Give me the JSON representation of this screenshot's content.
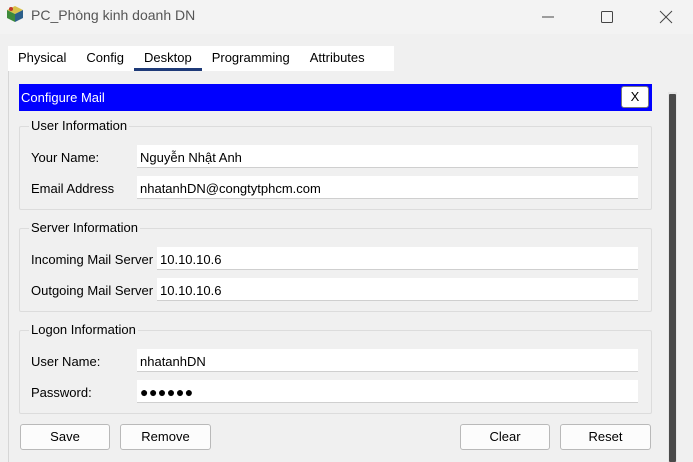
{
  "window": {
    "title": "PC_Phòng kinh doanh DN"
  },
  "tabs": [
    {
      "label": "Physical"
    },
    {
      "label": "Config"
    },
    {
      "label": "Desktop",
      "active": true
    },
    {
      "label": "Programming"
    },
    {
      "label": "Attributes"
    }
  ],
  "configure_mail": {
    "title": "Configure Mail",
    "close_label": "X",
    "colors": {
      "header_bg": "#0000ff",
      "active_tab_underline": "#1e3a78"
    },
    "user_information": {
      "legend": "User Information",
      "your_name_label": "Your Name:",
      "your_name_value": "Nguyễn Nhật Anh",
      "email_label": "Email Address",
      "email_value": "nhatanhDN@congtytphcm.com"
    },
    "server_information": {
      "legend": "Server Information",
      "incoming_label": "Incoming Mail Server",
      "incoming_value": "10.10.10.6",
      "outgoing_label": "Outgoing Mail Server",
      "outgoing_value": "10.10.10.6"
    },
    "logon_information": {
      "legend": "Logon Information",
      "username_label": "User Name:",
      "username_value": "nhatanhDN",
      "password_label": "Password:",
      "password_masked": "●●●●●●"
    },
    "buttons": {
      "save": "Save",
      "remove": "Remove",
      "clear": "Clear",
      "reset": "Reset"
    }
  }
}
